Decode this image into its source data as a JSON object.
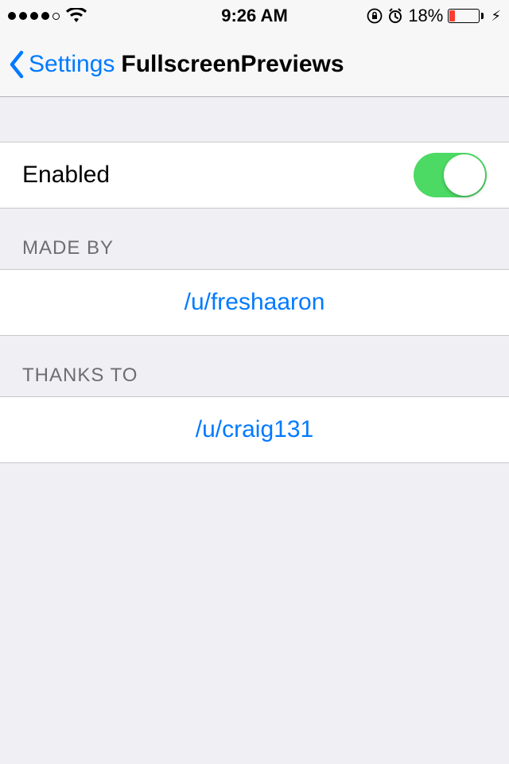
{
  "status_bar": {
    "time": "9:26 AM",
    "battery_pct": "18%"
  },
  "nav": {
    "back_label": "Settings",
    "title": "FullscreenPreviews"
  },
  "cells": {
    "enabled_label": "Enabled"
  },
  "sections": {
    "made_by_header": "MADE BY",
    "made_by_value": "/u/freshaaron",
    "thanks_to_header": "THANKS TO",
    "thanks_to_value": "/u/craig131"
  }
}
